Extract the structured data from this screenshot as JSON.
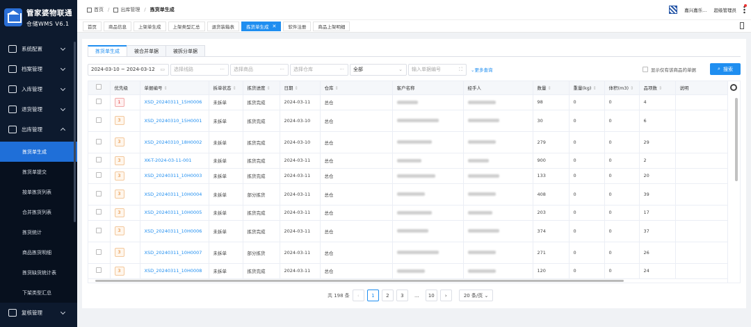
{
  "app": {
    "title": "管家婆物联通",
    "subtitle": "仓储WMS V6.1"
  },
  "sidebar": {
    "groups": [
      {
        "label": "系统配置",
        "icon": "settings-icon"
      },
      {
        "label": "档案管理",
        "icon": "archive-icon"
      },
      {
        "label": "入库管理",
        "icon": "inbound-icon"
      },
      {
        "label": "退货管理",
        "icon": "return-icon"
      },
      {
        "label": "出库管理",
        "icon": "outbound-icon"
      }
    ],
    "sub_items": [
      "拣货单生成",
      "拣货单提交",
      "按单拣货列表",
      "合并拣货列表",
      "拣货统计",
      "商品拣货明细",
      "拣货缺货统计表",
      "下架类型汇总"
    ],
    "bottom_group": {
      "label": "复核管理",
      "icon": "review-icon"
    }
  },
  "header": {
    "breadcrumb": [
      "首页",
      "出库管理",
      "拣货单生成"
    ],
    "user_store": "嘉兴嘉乐...",
    "user_role": "超级管理员"
  },
  "page_tabs": [
    "首页",
    "商品信息",
    "上架单生成",
    "上架类型汇总",
    "退货装箱表",
    "拣货单生成",
    "软件注册",
    "商品上架明细"
  ],
  "sub_tabs": [
    "拣货单生成",
    "被合并单据",
    "被拆分单据"
  ],
  "filters": {
    "date_range": "2024-03-10  ~  2024-03-12",
    "route_placeholder": "选择线路",
    "goods_placeholder": "选择商品",
    "warehouse_placeholder": "选择仓库",
    "status_value": "全部",
    "order_no_placeholder": "输入单据编号",
    "more_label": "更多查询",
    "show_only_label": "显示仅有该商品的单据",
    "search_label": "搜索"
  },
  "table": {
    "columns": [
      "优先级",
      "单据编号",
      "拆单状态",
      "拣货进度",
      "日期",
      "仓库",
      "客户名称",
      "经手人",
      "数量",
      "重量(kg)",
      "体积(m3)",
      "品项数",
      "说明"
    ],
    "rows": [
      {
        "priority": "1",
        "priority_red": true,
        "order_no": "XSD_20240311_15H0006",
        "split": "未拆单",
        "progress": "拣货完成",
        "date": "2024-03-11",
        "warehouse": "总仓",
        "qty": "98",
        "weight": "0",
        "volume": "0",
        "items": "4"
      },
      {
        "priority": "3",
        "priority_red": false,
        "order_no": "XSD_20240310_15H0001",
        "split": "未拆单",
        "progress": "拣货完成",
        "date": "2024-03-10",
        "warehouse": "总仓",
        "qty": "30",
        "weight": "0",
        "volume": "0",
        "items": "6"
      },
      {
        "priority": "3",
        "priority_red": false,
        "order_no": "XSD_20240310_18H0002",
        "split": "未拆单",
        "progress": "拣货完成",
        "date": "2024-03-10",
        "warehouse": "总仓",
        "qty": "279",
        "weight": "0",
        "volume": "0",
        "items": "29"
      },
      {
        "priority": "3",
        "priority_red": false,
        "order_no": "XK-T-2024-03-11-001",
        "split": "未拆单",
        "progress": "拣货完成",
        "date": "2024-03-11",
        "warehouse": "总仓",
        "qty": "900",
        "weight": "0",
        "volume": "0",
        "items": "2"
      },
      {
        "priority": "3",
        "priority_red": false,
        "order_no": "XSD_20240311_10H0003",
        "split": "未拆单",
        "progress": "拣货完成",
        "date": "2024-03-11",
        "warehouse": "总仓",
        "qty": "133",
        "weight": "0",
        "volume": "0",
        "items": "20"
      },
      {
        "priority": "3",
        "priority_red": false,
        "order_no": "XSD_20240311_10H0004",
        "split": "未拆单",
        "progress": "部分拣货",
        "date": "2024-03-11",
        "warehouse": "总仓",
        "qty": "408",
        "weight": "0",
        "volume": "0",
        "items": "39"
      },
      {
        "priority": "3",
        "priority_red": false,
        "order_no": "XSD_20240311_10H0005",
        "split": "未拆单",
        "progress": "拣货完成",
        "date": "2024-03-11",
        "warehouse": "总仓",
        "qty": "203",
        "weight": "0",
        "volume": "0",
        "items": "17"
      },
      {
        "priority": "3",
        "priority_red": false,
        "order_no": "XSD_20240311_10H0006",
        "split": "未拆单",
        "progress": "拣货完成",
        "date": "2024-03-11",
        "warehouse": "总仓",
        "qty": "374",
        "weight": "0",
        "volume": "0",
        "items": "37"
      },
      {
        "priority": "3",
        "priority_red": false,
        "order_no": "XSD_20240311_10H0007",
        "split": "未拆单",
        "progress": "部分拣货",
        "date": "2024-03-11",
        "warehouse": "总仓",
        "qty": "271",
        "weight": "0",
        "volume": "0",
        "items": "26"
      },
      {
        "priority": "3",
        "priority_red": false,
        "order_no": "XSD_20240311_10H0008",
        "split": "未拆单",
        "progress": "拣货完成",
        "date": "2024-03-11",
        "warehouse": "总仓",
        "qty": "120",
        "weight": "0",
        "volume": "0",
        "items": "24"
      }
    ]
  },
  "pagination": {
    "total_label": "共 198 条",
    "pages": [
      "1",
      "2",
      "3",
      "...",
      "10"
    ],
    "current": "1",
    "page_size": "20 条/页"
  },
  "colors": {
    "accent": "#1f8ef0",
    "sidebar_bg": "#0d1a2e",
    "active_menu": "#1f6fd8"
  }
}
